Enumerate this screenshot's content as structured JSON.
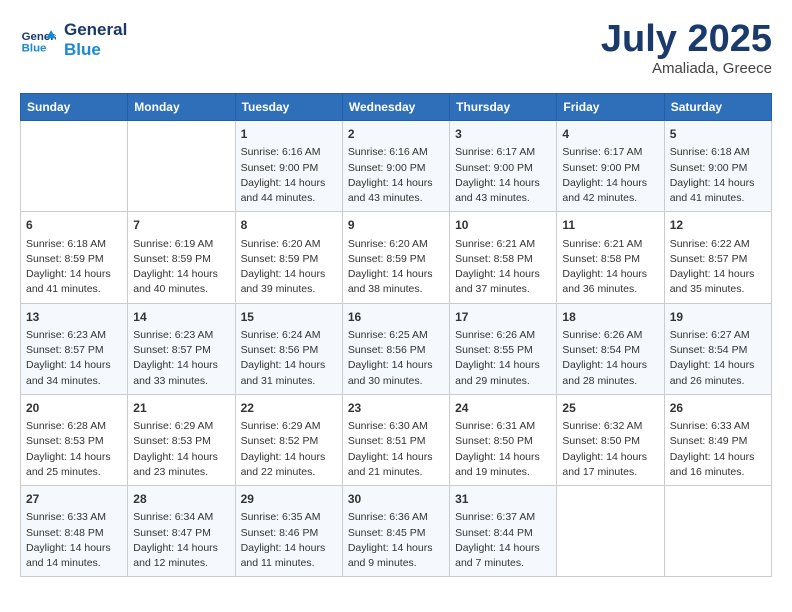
{
  "header": {
    "logo_line1": "General",
    "logo_line2": "Blue",
    "month": "July 2025",
    "location": "Amaliada, Greece"
  },
  "weekdays": [
    "Sunday",
    "Monday",
    "Tuesday",
    "Wednesday",
    "Thursday",
    "Friday",
    "Saturday"
  ],
  "weeks": [
    [
      {
        "day": "",
        "info": ""
      },
      {
        "day": "",
        "info": ""
      },
      {
        "day": "1",
        "info": "Sunrise: 6:16 AM\nSunset: 9:00 PM\nDaylight: 14 hours and 44 minutes."
      },
      {
        "day": "2",
        "info": "Sunrise: 6:16 AM\nSunset: 9:00 PM\nDaylight: 14 hours and 43 minutes."
      },
      {
        "day": "3",
        "info": "Sunrise: 6:17 AM\nSunset: 9:00 PM\nDaylight: 14 hours and 43 minutes."
      },
      {
        "day": "4",
        "info": "Sunrise: 6:17 AM\nSunset: 9:00 PM\nDaylight: 14 hours and 42 minutes."
      },
      {
        "day": "5",
        "info": "Sunrise: 6:18 AM\nSunset: 9:00 PM\nDaylight: 14 hours and 41 minutes."
      }
    ],
    [
      {
        "day": "6",
        "info": "Sunrise: 6:18 AM\nSunset: 8:59 PM\nDaylight: 14 hours and 41 minutes."
      },
      {
        "day": "7",
        "info": "Sunrise: 6:19 AM\nSunset: 8:59 PM\nDaylight: 14 hours and 40 minutes."
      },
      {
        "day": "8",
        "info": "Sunrise: 6:20 AM\nSunset: 8:59 PM\nDaylight: 14 hours and 39 minutes."
      },
      {
        "day": "9",
        "info": "Sunrise: 6:20 AM\nSunset: 8:59 PM\nDaylight: 14 hours and 38 minutes."
      },
      {
        "day": "10",
        "info": "Sunrise: 6:21 AM\nSunset: 8:58 PM\nDaylight: 14 hours and 37 minutes."
      },
      {
        "day": "11",
        "info": "Sunrise: 6:21 AM\nSunset: 8:58 PM\nDaylight: 14 hours and 36 minutes."
      },
      {
        "day": "12",
        "info": "Sunrise: 6:22 AM\nSunset: 8:57 PM\nDaylight: 14 hours and 35 minutes."
      }
    ],
    [
      {
        "day": "13",
        "info": "Sunrise: 6:23 AM\nSunset: 8:57 PM\nDaylight: 14 hours and 34 minutes."
      },
      {
        "day": "14",
        "info": "Sunrise: 6:23 AM\nSunset: 8:57 PM\nDaylight: 14 hours and 33 minutes."
      },
      {
        "day": "15",
        "info": "Sunrise: 6:24 AM\nSunset: 8:56 PM\nDaylight: 14 hours and 31 minutes."
      },
      {
        "day": "16",
        "info": "Sunrise: 6:25 AM\nSunset: 8:56 PM\nDaylight: 14 hours and 30 minutes."
      },
      {
        "day": "17",
        "info": "Sunrise: 6:26 AM\nSunset: 8:55 PM\nDaylight: 14 hours and 29 minutes."
      },
      {
        "day": "18",
        "info": "Sunrise: 6:26 AM\nSunset: 8:54 PM\nDaylight: 14 hours and 28 minutes."
      },
      {
        "day": "19",
        "info": "Sunrise: 6:27 AM\nSunset: 8:54 PM\nDaylight: 14 hours and 26 minutes."
      }
    ],
    [
      {
        "day": "20",
        "info": "Sunrise: 6:28 AM\nSunset: 8:53 PM\nDaylight: 14 hours and 25 minutes."
      },
      {
        "day": "21",
        "info": "Sunrise: 6:29 AM\nSunset: 8:53 PM\nDaylight: 14 hours and 23 minutes."
      },
      {
        "day": "22",
        "info": "Sunrise: 6:29 AM\nSunset: 8:52 PM\nDaylight: 14 hours and 22 minutes."
      },
      {
        "day": "23",
        "info": "Sunrise: 6:30 AM\nSunset: 8:51 PM\nDaylight: 14 hours and 21 minutes."
      },
      {
        "day": "24",
        "info": "Sunrise: 6:31 AM\nSunset: 8:50 PM\nDaylight: 14 hours and 19 minutes."
      },
      {
        "day": "25",
        "info": "Sunrise: 6:32 AM\nSunset: 8:50 PM\nDaylight: 14 hours and 17 minutes."
      },
      {
        "day": "26",
        "info": "Sunrise: 6:33 AM\nSunset: 8:49 PM\nDaylight: 14 hours and 16 minutes."
      }
    ],
    [
      {
        "day": "27",
        "info": "Sunrise: 6:33 AM\nSunset: 8:48 PM\nDaylight: 14 hours and 14 minutes."
      },
      {
        "day": "28",
        "info": "Sunrise: 6:34 AM\nSunset: 8:47 PM\nDaylight: 14 hours and 12 minutes."
      },
      {
        "day": "29",
        "info": "Sunrise: 6:35 AM\nSunset: 8:46 PM\nDaylight: 14 hours and 11 minutes."
      },
      {
        "day": "30",
        "info": "Sunrise: 6:36 AM\nSunset: 8:45 PM\nDaylight: 14 hours and 9 minutes."
      },
      {
        "day": "31",
        "info": "Sunrise: 6:37 AM\nSunset: 8:44 PM\nDaylight: 14 hours and 7 minutes."
      },
      {
        "day": "",
        "info": ""
      },
      {
        "day": "",
        "info": ""
      }
    ]
  ]
}
